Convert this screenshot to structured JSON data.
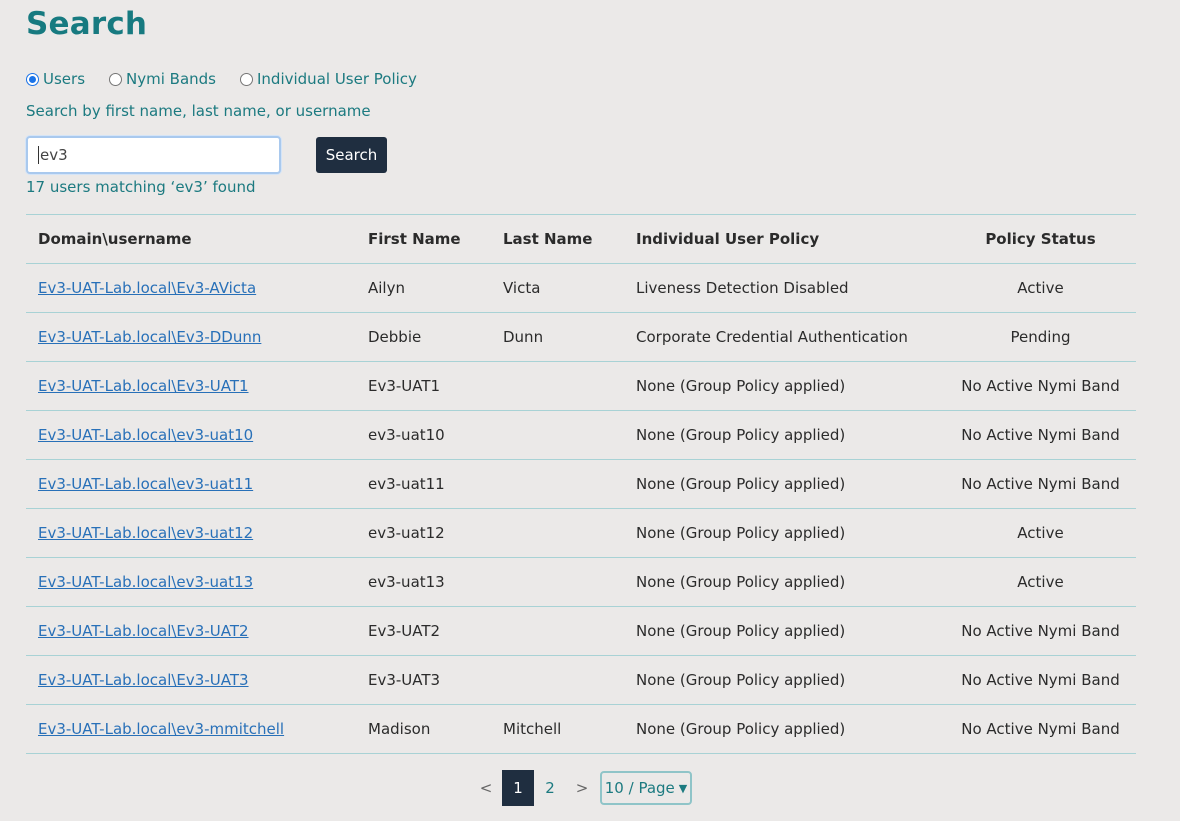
{
  "page": {
    "title": "Search"
  },
  "search_type": {
    "options": [
      "Users",
      "Nymi Bands",
      "Individual User Policy"
    ],
    "selected": "Users"
  },
  "helper_text": "Search by first name, last name, or username",
  "search": {
    "value": "ev3",
    "button_label": "Search"
  },
  "result_count": "17 users matching ‘ev3’ found",
  "table": {
    "headers": [
      "Domain\\username",
      "First Name",
      "Last Name",
      "Individual User Policy",
      "Policy Status"
    ],
    "rows": [
      {
        "username": "Ev3-UAT-Lab.local\\Ev3-AVicta",
        "first": "Ailyn",
        "last": "Victa",
        "policy": "Liveness Detection Disabled",
        "status": "Active"
      },
      {
        "username": "Ev3-UAT-Lab.local\\Ev3-DDunn",
        "first": "Debbie",
        "last": "Dunn",
        "policy": "Corporate Credential Authentication",
        "status": "Pending"
      },
      {
        "username": "Ev3-UAT-Lab.local\\Ev3-UAT1",
        "first": "Ev3-UAT1",
        "last": "",
        "policy": "None (Group Policy applied)",
        "status": "No Active Nymi Band"
      },
      {
        "username": "Ev3-UAT-Lab.local\\ev3-uat10",
        "first": "ev3-uat10",
        "last": "",
        "policy": "None (Group Policy applied)",
        "status": "No Active Nymi Band"
      },
      {
        "username": "Ev3-UAT-Lab.local\\ev3-uat11",
        "first": "ev3-uat11",
        "last": "",
        "policy": "None (Group Policy applied)",
        "status": "No Active Nymi Band"
      },
      {
        "username": "Ev3-UAT-Lab.local\\ev3-uat12",
        "first": "ev3-uat12",
        "last": "",
        "policy": "None (Group Policy applied)",
        "status": "Active"
      },
      {
        "username": "Ev3-UAT-Lab.local\\ev3-uat13",
        "first": "ev3-uat13",
        "last": "",
        "policy": "None (Group Policy applied)",
        "status": "Active"
      },
      {
        "username": "Ev3-UAT-Lab.local\\Ev3-UAT2",
        "first": "Ev3-UAT2",
        "last": "",
        "policy": "None (Group Policy applied)",
        "status": "No Active Nymi Band"
      },
      {
        "username": "Ev3-UAT-Lab.local\\Ev3-UAT3",
        "first": "Ev3-UAT3",
        "last": "",
        "policy": "None (Group Policy applied)",
        "status": "No Active Nymi Band"
      },
      {
        "username": "Ev3-UAT-Lab.local\\ev3-mmitchell",
        "first": "Madison",
        "last": "Mitchell",
        "policy": "None (Group Policy applied)",
        "status": "No Active Nymi Band"
      }
    ]
  },
  "pagination": {
    "prev": "<",
    "next": ">",
    "pages": [
      "1",
      "2"
    ],
    "current": "1",
    "page_size": "10 / Page"
  }
}
